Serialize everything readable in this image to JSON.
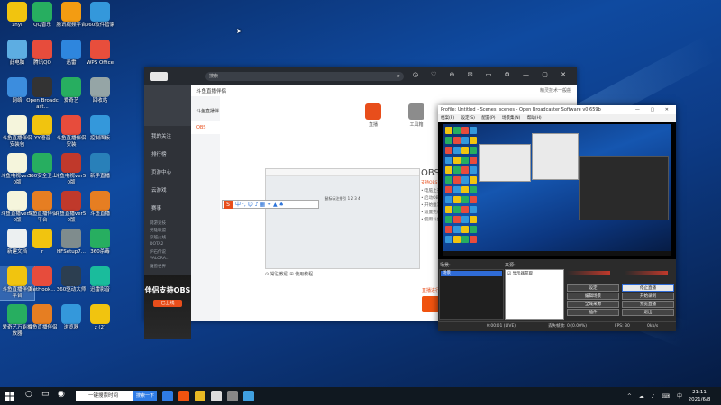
{
  "desktop_icons": [
    {
      "label": "zhyi",
      "color": "#f1c40f"
    },
    {
      "label": "QQ音乐",
      "color": "#27ae60"
    },
    {
      "label": "腾讯视频平台",
      "color": "#f39c12"
    },
    {
      "label": "360软件管家",
      "color": "#3498db"
    },
    {
      "label": "此电脑",
      "color": "#5dade2"
    },
    {
      "label": "腾讯QQ",
      "color": "#e74c3c"
    },
    {
      "label": "迅雷",
      "color": "#2e86de"
    },
    {
      "label": "WPS Office",
      "color": "#e84e3c"
    },
    {
      "label": "网络",
      "color": "#3c8dde"
    },
    {
      "label": "Open Broadcast...",
      "color": "#333333"
    },
    {
      "label": "爱奇艺",
      "color": "#27ae60"
    },
    {
      "label": "回收站",
      "color": "#95a5a6"
    },
    {
      "label": "斗鱼直播伴侣安装包",
      "color": "#f5f5dc"
    },
    {
      "label": "YY语音",
      "color": "#f1c40f"
    },
    {
      "label": "斗鱼直播伴侣安装",
      "color": "#e74c3c"
    },
    {
      "label": "控制面板",
      "color": "#3498db"
    },
    {
      "label": "斗鱼电视ver5.0版",
      "color": "#f5f5dc"
    },
    {
      "label": "360安全卫士",
      "color": "#27ae60"
    },
    {
      "label": "斗鱼电视ver5.0版",
      "color": "#c0392b"
    },
    {
      "label": "新手直播",
      "color": "#2980b9"
    },
    {
      "label": "斗鱼直播ver5.0版",
      "color": "#f5f5dc"
    },
    {
      "label": "斗鱼直播伴侣平台",
      "color": "#e67e22"
    },
    {
      "label": "斗鱼直播ver5.0版",
      "color": "#c0392b"
    },
    {
      "label": "斗鱼直播",
      "color": "#e67e22"
    },
    {
      "label": "新建文档",
      "color": "#ecf0f1"
    },
    {
      "label": "r",
      "color": "#f1c40f"
    },
    {
      "label": "HFSetup7...",
      "color": "#7f8c8d"
    },
    {
      "label": "360杀毒",
      "color": "#27ae60"
    },
    {
      "label": "斗鱼直播伴侣平台",
      "color": "#f1c40f"
    },
    {
      "label": "NetHook...",
      "color": "#e74c3c"
    },
    {
      "label": "360驱动大师",
      "color": "#2c3e50"
    },
    {
      "label": "迅雷影音",
      "color": "#1abc9c"
    },
    {
      "label": "爱奇艺万能播放器",
      "color": "#27ae60"
    },
    {
      "label": "斗鱼直播伴侣",
      "color": "#e67e22"
    },
    {
      "label": "浏览器",
      "color": "#3498db"
    },
    {
      "label": "z (2)",
      "color": "#f1c40f"
    }
  ],
  "douyu": {
    "search_placeholder": "搜索",
    "subtitle": "斗鱼直播伴侣",
    "sub_right": "精灵技术一般般",
    "side_items": [
      "我的关注",
      "排行榜",
      "页游中心",
      "云游戏",
      "赛事"
    ],
    "side_small": [
      "网游竞技",
      "英雄联盟",
      "穿越火线",
      "DOTA2",
      "炉石传说",
      "VALORA...",
      "魔兽世界"
    ],
    "nav_items": [
      "斗鱼直播伴侣",
      "OBS"
    ],
    "banner_title": "伴侣支持OBS",
    "banner_btn": "已上线",
    "tools": [
      {
        "label": "直播",
        "color": "#e84e1b"
      },
      {
        "label": "工具箱",
        "color": "#888888"
      }
    ],
    "shot_title": "Profile: Untitled - Scenes: scenes - Open Broadcaster Software v0.659b",
    "shot_center": "鼠标标注指引 1 2 3 4",
    "float_label": "中 ·, ☺ ♪ ▦ ✦ ▲ ♠",
    "obs_title": "OBS",
    "obs_orange": "支持OBS直播的最佳方式",
    "obs_lines": [
      "• 电脑上安装OBS",
      "• 启动OBS",
      "• 开始推流",
      "• 设置完成",
      "• 使用斗鱼"
    ],
    "links": "⊙ 常驻教程     ⊞ 使用教程",
    "choose": "选择OBS",
    "tip": "直播进行中，在OBS进行直播推流",
    "btn": "直播工具正在运行"
  },
  "obs": {
    "title": "Profile: Untitled - Scenes: scenes - Open Broadcaster Software v0.659b",
    "menu": "档案(F) 设定(S) 配置(P) 场景集(N) 帮助(H)",
    "scenes_label": "场景:",
    "sources_label": "来源:",
    "scene_item": "场景",
    "source_item": "☑ 显示器获取",
    "buttons_left": [
      "设定",
      "编辑场景",
      "全域来源",
      "插件"
    ],
    "buttons_right": [
      "停止直播",
      "开始录制",
      "预览直播",
      "退出"
    ],
    "status_time": "0:00:01 (LIVE)",
    "status_drop": "丢失帧数: 0 (0.00%)",
    "status_fps": "FPS: 30",
    "status_kbps": "0kb/s"
  },
  "taskbar": {
    "search_placeholder": "一键搜索时间",
    "search_btn": "搜索一下",
    "apps": [
      {
        "color": "#2f7ce6"
      },
      {
        "color": "#f0530f"
      },
      {
        "color": "#e8b923"
      },
      {
        "color": "#dddddd"
      },
      {
        "color": "#888888"
      },
      {
        "color": "#40a0e0"
      }
    ],
    "time": "21:11",
    "date": "2021/6/8"
  }
}
